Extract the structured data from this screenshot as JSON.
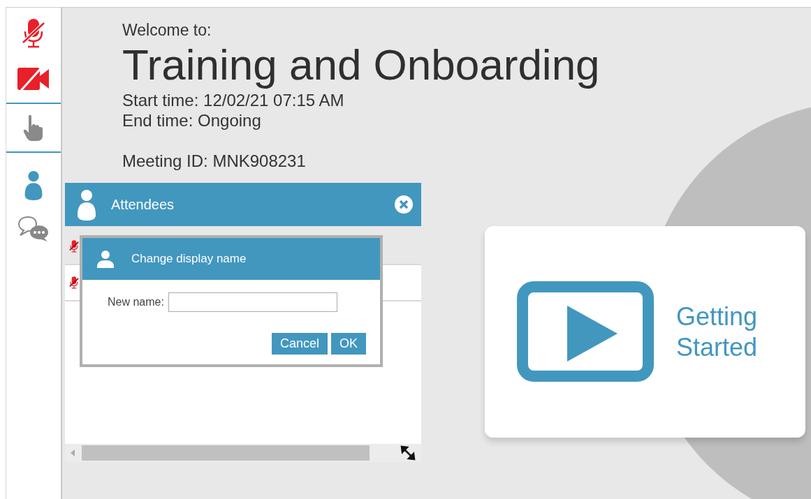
{
  "sidebar": {
    "items": [
      {
        "kind": "mic",
        "muted": true
      },
      {
        "kind": "camera",
        "muted": true
      },
      {
        "kind": "hand"
      },
      {
        "kind": "attendees",
        "selected": true
      },
      {
        "kind": "chat",
        "selected": false
      }
    ]
  },
  "meeting": {
    "welcome": "Welcome to:",
    "title": "Training and Onboarding",
    "start_time": "Start time: 12/02/21 07:15 AM",
    "end_time": "End time: Ongoing",
    "meeting_id": "Meeting ID: MNK908231"
  },
  "attendees_panel": {
    "title": "Attendees",
    "rows": [
      {
        "muted": true,
        "selected": true
      },
      {
        "muted": true,
        "selected": false
      }
    ]
  },
  "dialog": {
    "title": "Change display name",
    "field_label": "New name:",
    "buttons": [
      "Cancel",
      "OK"
    ]
  },
  "card": {
    "label_line_1": "Getting",
    "label_line_2": "Started"
  }
}
